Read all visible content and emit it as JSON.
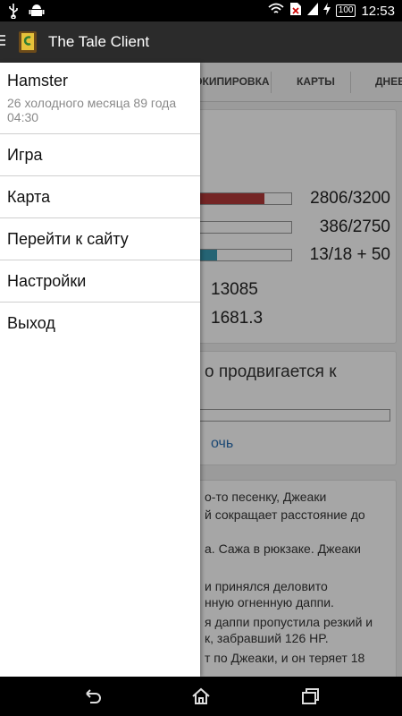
{
  "status_bar": {
    "battery": "100",
    "time": "12:53"
  },
  "app": {
    "title": "The Tale Client"
  },
  "tabs": [
    "ЭКИПИРОВКА",
    "КАРТЫ",
    "ДНЕВ"
  ],
  "background": {
    "stats": [
      "2806/3200",
      "386/2750",
      "13/18 + 50",
      "13085",
      "1681.3"
    ],
    "action_text": "о продвигается к",
    "help_link": "очь",
    "log_lines": [
      "о-то песенку, Джеаки",
      "й сокращает расстояние до",
      "а. Сажа в рюкзаке. Джеаки",
      "и принялся деловито",
      "нную огненную даппи.",
      "я даппи пропустила резкий и",
      "к, забравший 126 HP.",
      "т по Джеаки, и он теряет 18"
    ]
  },
  "drawer": {
    "hero_name": "Hamster",
    "game_date": "26 холодного месяца 89 года 04:30",
    "items": [
      "Игра",
      "Карта",
      "Перейти к сайту",
      "Настройки",
      "Выход"
    ]
  }
}
